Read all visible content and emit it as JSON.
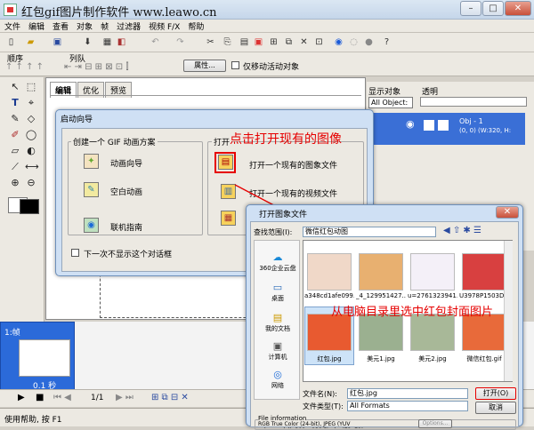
{
  "window": {
    "title": "红包gif图片制作软件 www.leawo.cn"
  },
  "menu": [
    "文件",
    "编辑",
    "查看",
    "对象",
    "帧",
    "过滤器",
    "视频 F/X",
    "帮助"
  ],
  "toolbar2": {
    "order_label": "顺序",
    "queue_label": "列队",
    "properties_button": "属性...",
    "only_active_label": "仅移动活动对象"
  },
  "editor_tabs": [
    "编辑",
    "优化",
    "预览"
  ],
  "right_panel": {
    "display_objects_label": "显示对象",
    "display_objects_value": "All Object:",
    "transparency_label": "透明",
    "object_name": "Obj - 1",
    "object_info": "(0, 0) (W:320, H:"
  },
  "frame": {
    "label": "1:帧",
    "duration": "0.1 秒"
  },
  "playback": {
    "frame_counter": "1/1"
  },
  "status_text": "使用帮助, 按 F1",
  "startup_dialog": {
    "title": "启动向导",
    "create_group_title": "创建一个 GIF 动画方案",
    "animation_wizard": "动画向导",
    "blank_animation": "空白动画",
    "online_guide": "联机指南",
    "open_group_title": "打开",
    "open_existing_image": "打开一个现有的图象文件",
    "open_existing_video": "打开一个现有的视频文件",
    "dont_show_again": "下一次不显示这个对话框"
  },
  "annotations": {
    "top": "点击打开现有的图像",
    "bottom": "从电脑目录里选中红包封面图片"
  },
  "open_dialog": {
    "title": "打开图象文件",
    "look_in_label": "查找范围(I):",
    "look_in_value": "微信红包动图",
    "places": [
      "360企业云盘",
      "桌面",
      "我的文档",
      "计算机",
      "网络"
    ],
    "files": [
      "a348cd1afe099...",
      "_4_129951427...",
      "u=2761323941...",
      "U3978P1503D...",
      "红包.jpg",
      "美元1.jpg",
      "美元2.jpg",
      "微信红包.gif"
    ],
    "filename_label": "文件名(N):",
    "filename_value": "红包.jpg",
    "filetype_label": "文件类型(T):",
    "filetype_value": "All Formats",
    "open_button": "打开(O)",
    "cancel_button": "取消",
    "info_title": "File information",
    "info_text": "RGB True Color (24-bit), JPEG (YUV color model), 300 x 139 Pixels, (72, 72)",
    "options_button": "Options...",
    "browse_button": "Browse..."
  },
  "colors": {
    "selection": "#3a6fd6",
    "annotation": "#e60000"
  }
}
